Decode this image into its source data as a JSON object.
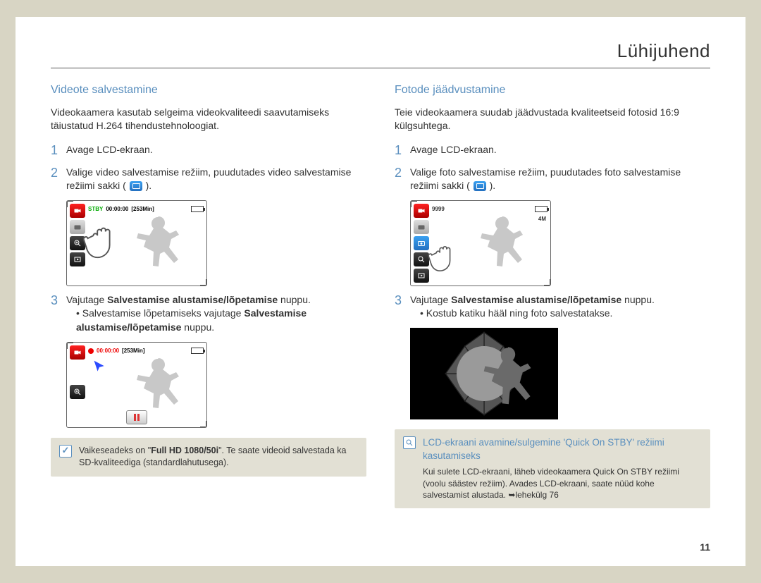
{
  "page_title": "Lühijuhend",
  "page_number": "11",
  "left": {
    "heading": "Videote salvestamine",
    "intro": "Videokaamera kasutab selgeima videokvaliteedi saavutamiseks täiustatud H.264 tihendustehnoloogiat.",
    "step1_num": "1",
    "step1_text": "Avage LCD-ekraan.",
    "step2_num": "2",
    "step2_text_a": "Valige video salvestamise režiim, puudutades video salvestamise režiimi sakki (",
    "step2_text_b": ").",
    "step3_num": "3",
    "step3_text_a": "Vajutage ",
    "step3_text_b": "Salvestamise alustamise/lõpetamise",
    "step3_text_c": " nuppu.",
    "step3_bul1_a": "Salvestamise lõpetamiseks vajutage ",
    "step3_bul1_b": "Salvestamise alustamise/lõpetamise",
    "step3_bul1_c": " nuppu.",
    "note_a": "Vaikeseadeks on \"",
    "note_b": "Full HD  1080/50i",
    "note_c": "\". Te saate videoid salvestada ka SD-kvaliteediga (standardlahutusega).",
    "screen1_stby": "STBY",
    "screen1_time": "00:00:00",
    "screen1_remain": "[253Min]",
    "screen2_time": "00:00:00",
    "screen2_remain": "[253Min]"
  },
  "right": {
    "heading": "Fotode jäädvustamine",
    "intro": "Teie videokaamera suudab jäädvustada kvaliteetseid fotosid 16:9 külgsuhtega.",
    "step1_num": "1",
    "step1_text": "Avage LCD-ekraan.",
    "step2_num": "2",
    "step2_text_a": "Valige foto salvestamise režiim, puudutades foto salvestamise režiimi sakki (",
    "step2_text_b": ").",
    "step3_num": "3",
    "step3_text_a": "Vajutage ",
    "step3_text_b": "Salvestamise alustamise/lõpetamise",
    "step3_text_c": " nuppu.",
    "step3_bul1": "Kostub katiku hääl ning foto salvestatakse.",
    "screen_count": "9999",
    "screen_res": "4M",
    "note_title": "LCD-ekraani avamine/sulgemine 'Quick On STBY' režiimi kasutamiseks",
    "note_body_a": "Kui sulete LCD-ekraani, läheb videokaamera Quick On STBY režiimi (voolu säästev režiim).  Avades LCD-ekraani, saate nüüd kohe salvestamist alustada.  ",
    "note_body_b": "➥lehekülg 76"
  }
}
